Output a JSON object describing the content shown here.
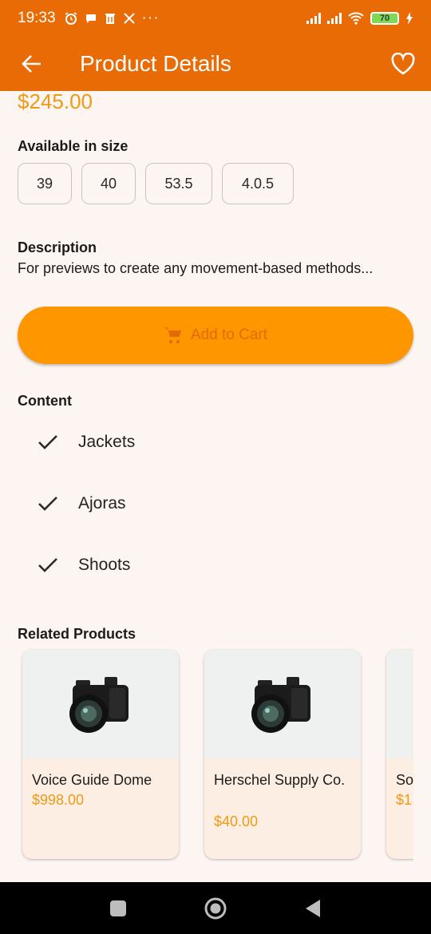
{
  "status_bar": {
    "time": "19:33",
    "icons_left": [
      "alarm-icon",
      "chat-bubble-icon",
      "trash-icon",
      "x-logo-icon",
      "more-dots-icon"
    ],
    "battery": "70",
    "icons_right": [
      "signal-icon",
      "signal-icon",
      "wifi-icon",
      "battery-icon",
      "charging-icon"
    ]
  },
  "app_bar": {
    "title": "Product Details",
    "back_icon": "arrow-left-icon",
    "favorite_icon": "heart-outline-icon"
  },
  "product": {
    "price": "$245.00",
    "sizes_label": "Available in size",
    "sizes": [
      "39",
      "40",
      "53.5",
      "4.0.5"
    ],
    "description_label": "Description",
    "description": "For previews to create any movement-based methods...",
    "add_to_cart_label": "Add to Cart",
    "cart_icon": "shopping-cart-icon"
  },
  "content": {
    "label": "Content",
    "items": [
      "Jackets",
      "Ajoras",
      "Shoots"
    ]
  },
  "related": {
    "label": "Related Products",
    "items": [
      {
        "name": "Voice Guide Dome",
        "price": "$998.00"
      },
      {
        "name": "Herschel Supply Co.",
        "price": "$40.00"
      },
      {
        "name": "So",
        "price": "$1"
      }
    ]
  },
  "colors": {
    "primary": "#e96b05",
    "accent": "#fe9600",
    "price": "#ee9a15",
    "background": "#fdf5f2",
    "card": "#fdeee3"
  },
  "nav": [
    "recents-square-icon",
    "home-circle-icon",
    "back-triangle-icon"
  ]
}
